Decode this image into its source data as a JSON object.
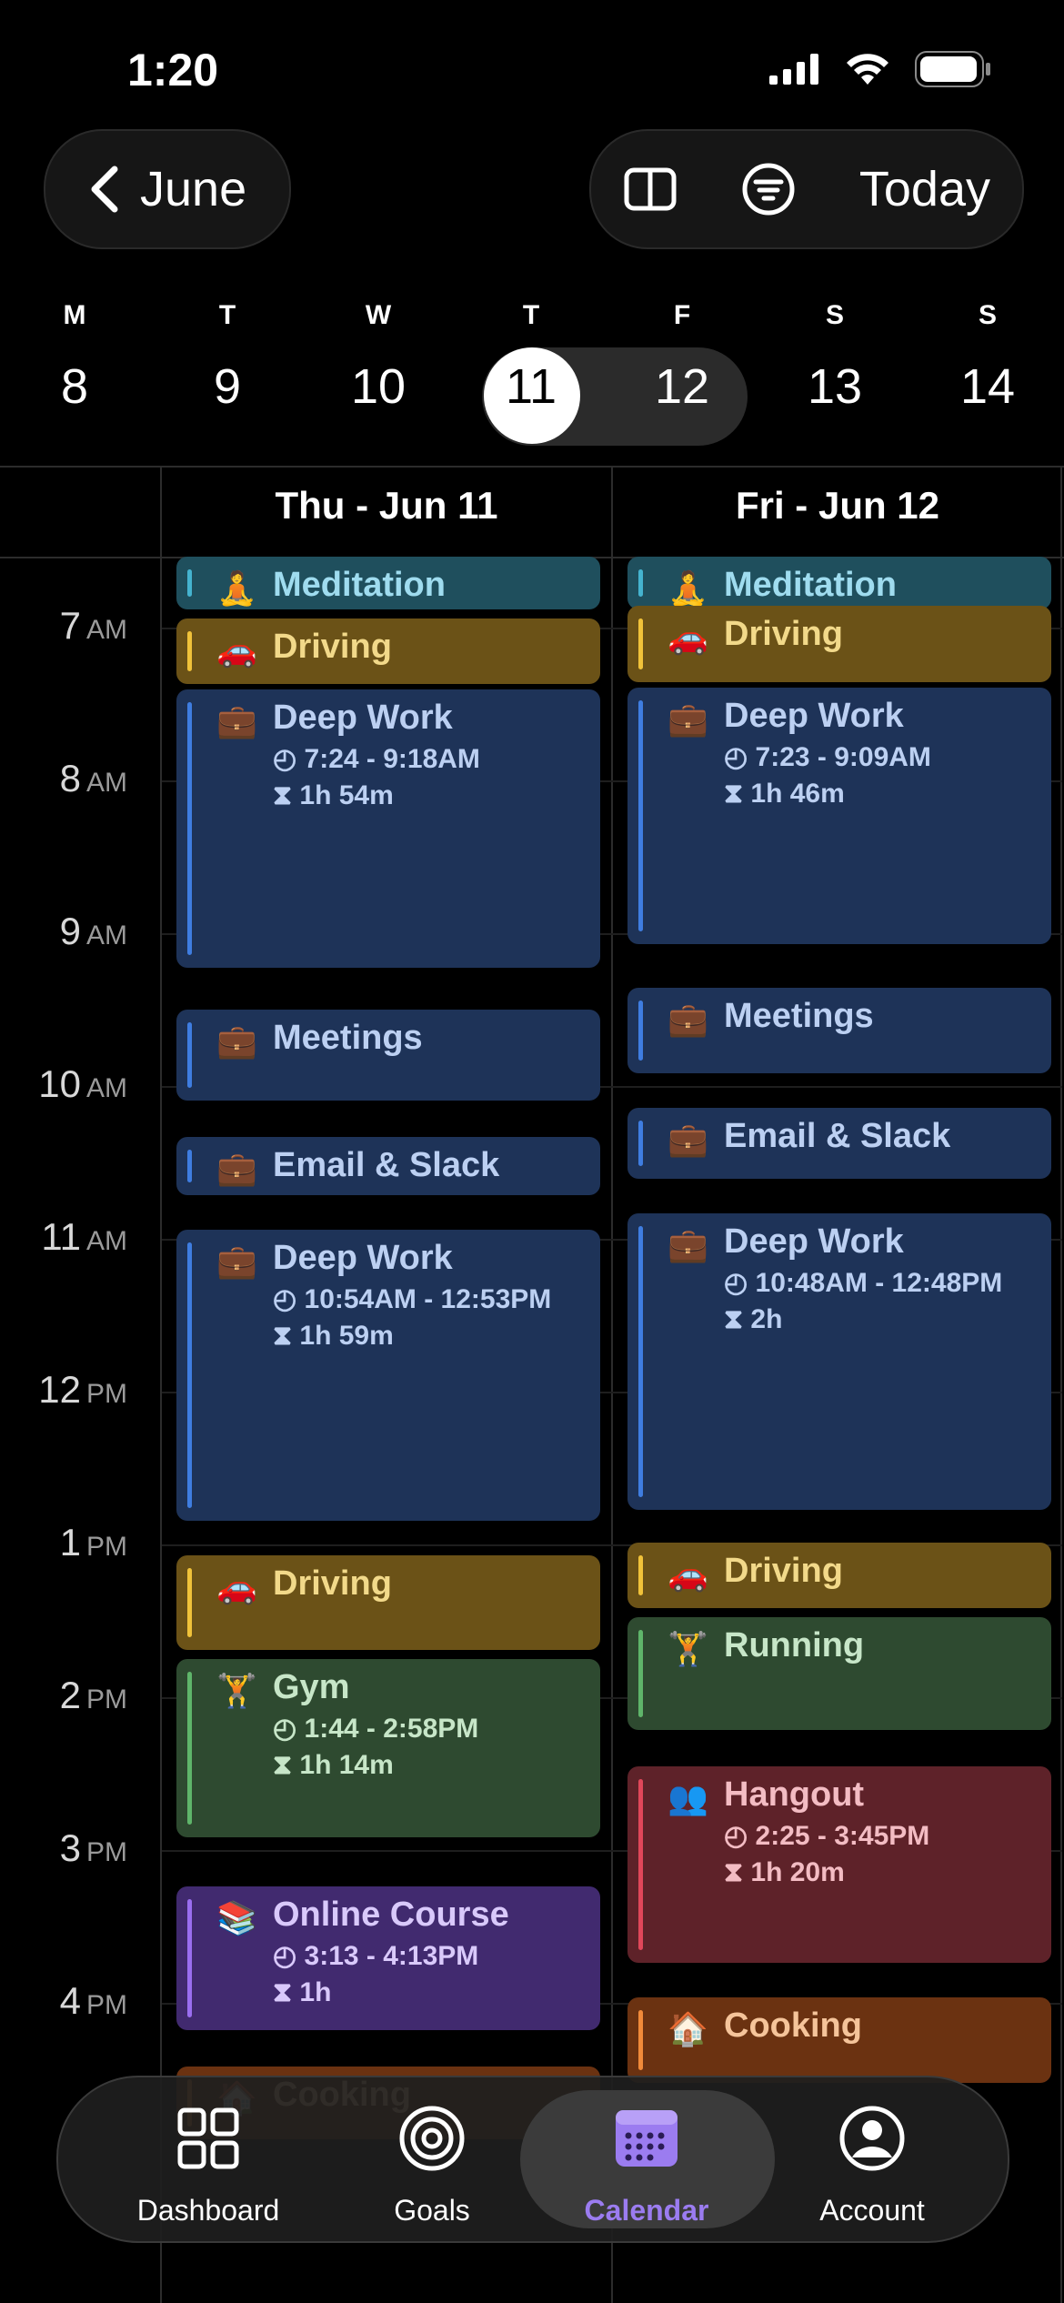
{
  "status": {
    "time": "1:20"
  },
  "nav": {
    "back_label": "June",
    "today_label": "Today"
  },
  "week": {
    "days": [
      {
        "letter": "M",
        "num": "8"
      },
      {
        "letter": "T",
        "num": "9"
      },
      {
        "letter": "W",
        "num": "10"
      },
      {
        "letter": "T",
        "num": "11"
      },
      {
        "letter": "F",
        "num": "12"
      },
      {
        "letter": "S",
        "num": "13"
      },
      {
        "letter": "S",
        "num": "14"
      }
    ]
  },
  "columns": [
    {
      "header": "Thu - Jun 11"
    },
    {
      "header": "Fri - Jun 12"
    }
  ],
  "hours": [
    {
      "h": "7",
      "p": "AM"
    },
    {
      "h": "8",
      "p": "AM"
    },
    {
      "h": "9",
      "p": "AM"
    },
    {
      "h": "10",
      "p": "AM"
    },
    {
      "h": "11",
      "p": "AM"
    },
    {
      "h": "12",
      "p": "PM"
    },
    {
      "h": "1",
      "p": "PM"
    },
    {
      "h": "2",
      "p": "PM"
    },
    {
      "h": "3",
      "p": "PM"
    },
    {
      "h": "4",
      "p": "PM"
    }
  ],
  "events": {
    "thu": [
      {
        "title": "Meditation",
        "emoji": "🧘",
        "time": "",
        "duration": "",
        "color": "#1f4f5d",
        "bar": "#45b3cf",
        "text": "#9fdcef"
      },
      {
        "title": "Driving",
        "emoji": "🚗",
        "time": "",
        "duration": "",
        "color": "#6b5217",
        "bar": "#f0c23a",
        "text": "#f2d98a"
      },
      {
        "title": "Deep Work",
        "emoji": "💼",
        "time": "7:24 - 9:18AM",
        "duration": "1h 54m",
        "color": "#1e3358",
        "bar": "#3f7de0",
        "text": "#bcd0f2"
      },
      {
        "title": "Meetings",
        "emoji": "💼",
        "time": "",
        "duration": "",
        "color": "#1e3358",
        "bar": "#3f7de0",
        "text": "#bcd0f2"
      },
      {
        "title": "Email & Slack",
        "emoji": "💼",
        "time": "",
        "duration": "",
        "color": "#1e3358",
        "bar": "#3f7de0",
        "text": "#bcd0f2"
      },
      {
        "title": "Deep Work",
        "emoji": "💼",
        "time": "10:54AM - 12:53PM",
        "duration": "1h 59m",
        "color": "#1e3358",
        "bar": "#3f7de0",
        "text": "#bcd0f2"
      },
      {
        "title": "Driving",
        "emoji": "🚗",
        "time": "",
        "duration": "",
        "color": "#6b5217",
        "bar": "#f0c23a",
        "text": "#f2d98a"
      },
      {
        "title": "Gym",
        "emoji": "🏋",
        "time": "1:44 - 2:58PM",
        "duration": "1h 14m",
        "color": "#2e4a30",
        "bar": "#5fb56a",
        "text": "#c7e6c8"
      },
      {
        "title": "Online Course",
        "emoji": "📚",
        "time": "3:13 - 4:13PM",
        "duration": "1h",
        "color": "#412a6f",
        "bar": "#9a6ef0",
        "text": "#d9c9fb"
      },
      {
        "title": "Cooking",
        "emoji": "🏠",
        "time": "",
        "duration": "",
        "color": "#6b3211",
        "bar": "#f08a3a",
        "text": "#f5c49a"
      }
    ],
    "fri": [
      {
        "title": "Meditation",
        "emoji": "🧘",
        "time": "",
        "duration": "",
        "color": "#1f4f5d",
        "bar": "#45b3cf",
        "text": "#9fdcef"
      },
      {
        "title": "Driving",
        "emoji": "🚗",
        "time": "",
        "duration": "",
        "color": "#6b5217",
        "bar": "#f0c23a",
        "text": "#f2d98a"
      },
      {
        "title": "Deep Work",
        "emoji": "💼",
        "time": "7:23 - 9:09AM",
        "duration": "1h 46m",
        "color": "#1e3358",
        "bar": "#3f7de0",
        "text": "#bcd0f2"
      },
      {
        "title": "Meetings",
        "emoji": "💼",
        "time": "",
        "duration": "",
        "color": "#1e3358",
        "bar": "#3f7de0",
        "text": "#bcd0f2"
      },
      {
        "title": "Email & Slack",
        "emoji": "💼",
        "time": "",
        "duration": "",
        "color": "#1e3358",
        "bar": "#3f7de0",
        "text": "#bcd0f2"
      },
      {
        "title": "Deep Work",
        "emoji": "💼",
        "time": "10:48AM - 12:48PM",
        "duration": "2h",
        "color": "#1e3358",
        "bar": "#3f7de0",
        "text": "#bcd0f2"
      },
      {
        "title": "Driving",
        "emoji": "🚗",
        "time": "",
        "duration": "",
        "color": "#6b5217",
        "bar": "#f0c23a",
        "text": "#f2d98a"
      },
      {
        "title": "Running",
        "emoji": "🏋",
        "time": "",
        "duration": "",
        "color": "#2e4a30",
        "bar": "#5fb56a",
        "text": "#c7e6c8"
      },
      {
        "title": "Hangout",
        "emoji": "👥",
        "time": "2:25 - 3:45PM",
        "duration": "1h 20m",
        "color": "#5e2229",
        "bar": "#e0475a",
        "text": "#f3bcc3"
      },
      {
        "title": "Cooking",
        "emoji": "🏠",
        "time": "",
        "duration": "",
        "color": "#6b3211",
        "bar": "#f08a3a",
        "text": "#f5c49a"
      }
    ]
  },
  "tabbar": {
    "tabs": [
      {
        "label": "Dashboard",
        "icon": "grid-icon"
      },
      {
        "label": "Goals",
        "icon": "target-icon"
      },
      {
        "label": "Calendar",
        "icon": "calendar-icon"
      },
      {
        "label": "Account",
        "icon": "person-icon"
      }
    ],
    "active_color": "#9b7cf0"
  }
}
